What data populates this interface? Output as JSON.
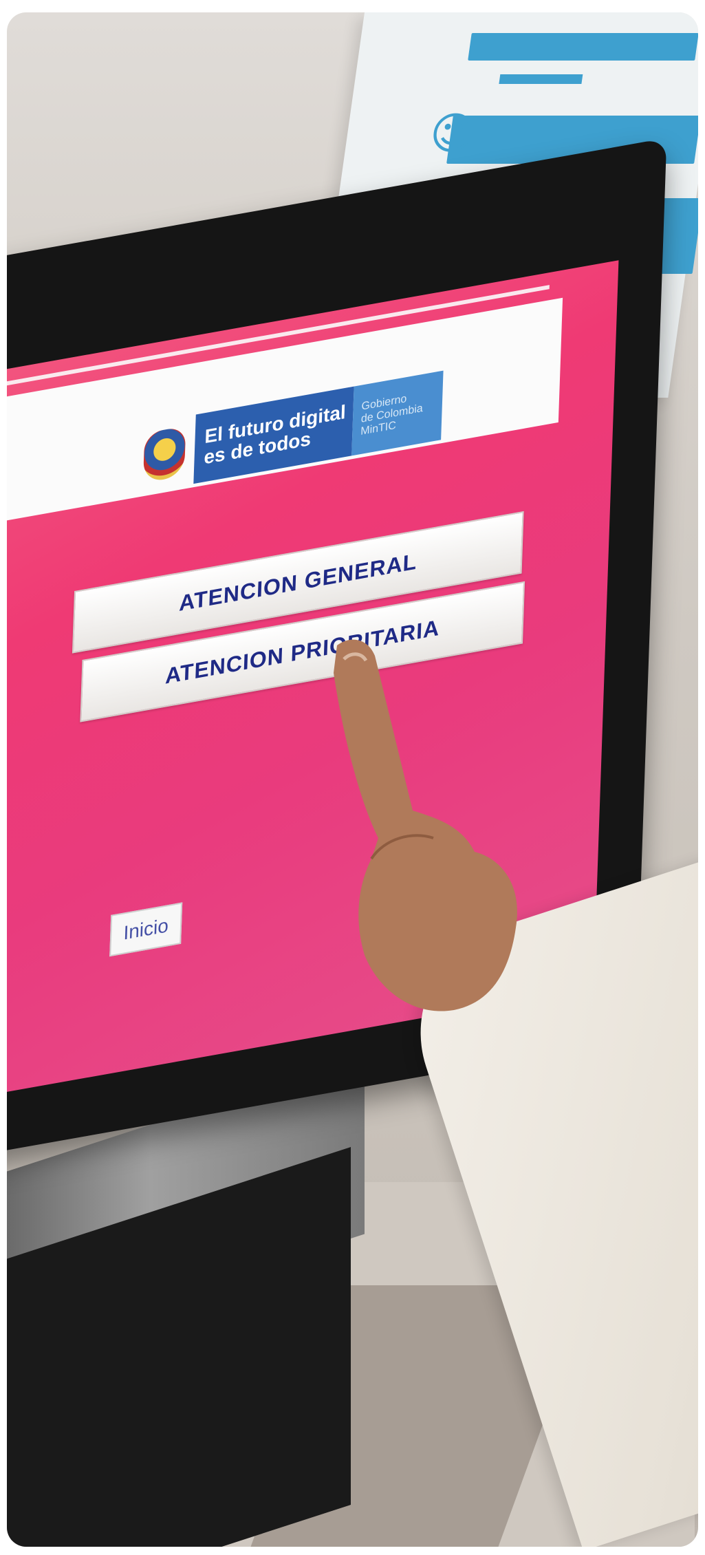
{
  "screen": {
    "brand_slogan_line1": "El futuro digital",
    "brand_slogan_line2": "es de todos",
    "gov_line1": "Gobierno",
    "gov_line2": "de Colombia",
    "gov_line3": "MinTIC",
    "buttons": [
      {
        "label": "ATENCION GENERAL"
      },
      {
        "label": "ATENCION PRIORITARIA"
      }
    ],
    "home_button_label": "Inicio"
  },
  "colors": {
    "screen_pink": "#ef3a74",
    "button_text_blue": "#1f2a86",
    "mintic_blue": "#2c5fae",
    "poster_blue": "#3ea0cf"
  },
  "icons": [
    "coat-of-arms-icon",
    "person-icon",
    "accessibility-icon"
  ]
}
